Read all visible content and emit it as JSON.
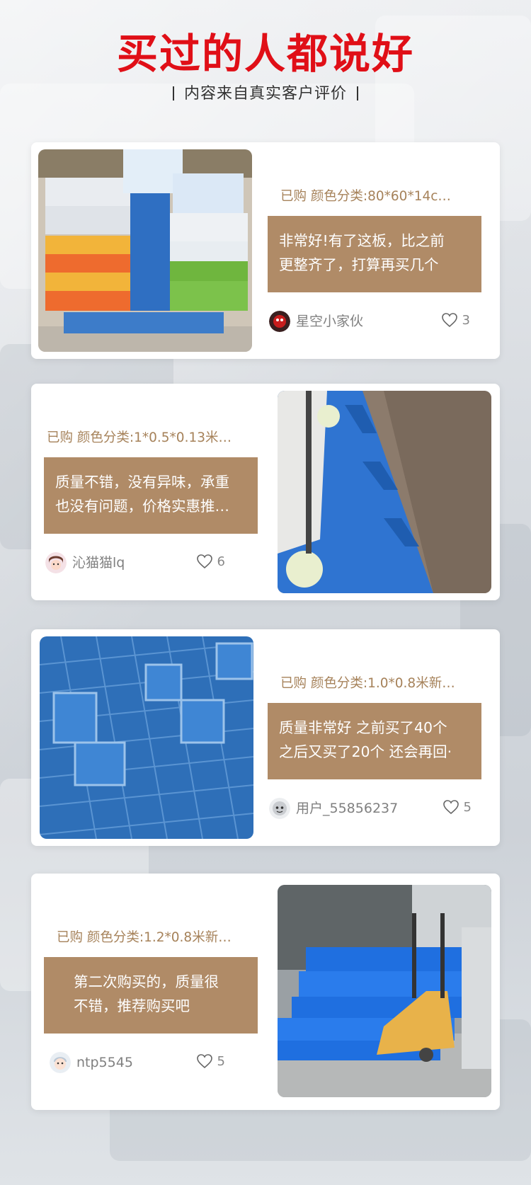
{
  "header": {
    "title": "买过的人都说好",
    "subtitle": "内容来自真实客户评价"
  },
  "colors": {
    "title_red": "#e00f17",
    "review_bg": "#b08b67",
    "purchase_text": "#a6825a",
    "card_bg": "#ffffff"
  },
  "reviews": [
    {
      "purchase": "已购 颜色分类:80*60*14c…",
      "text_lines": [
        "非常好!有了这板，比之前",
        "更整齐了，打算再买几个"
      ],
      "user": "星空小家伙",
      "likes": "3",
      "photo": "pallet-stacked-with-milk-boxes",
      "avatar_icon": "red-character-avatar-icon"
    },
    {
      "purchase": "已购 颜色分类:1*0.5*0.13米…",
      "text_lines": [
        "质量不错，没有异味，承重",
        "也没有问题，价格实惠推…"
      ],
      "user": "沁猫猫lq",
      "likes": "6",
      "photo": "blue-pallet-with-shelf-on-tiles",
      "avatar_icon": "cartoon-girl-avatar-icon"
    },
    {
      "purchase": "已购 颜色分类:1.0*0.8米新…",
      "text_lines": [
        "质量非常好 之前买了40个",
        "之后又买了20个 还会再回·"
      ],
      "user": "用户_55856237",
      "likes": "5",
      "photo": "blue-pallet-grid-underside",
      "avatar_icon": "gray-cartoon-avatar-icon"
    },
    {
      "purchase": "已购 颜色分类:1.2*0.8米新…",
      "text_lines": [
        "第二次购买的，质量很",
        "不错，推荐购买吧"
      ],
      "user": "ntp5545",
      "likes": "5",
      "photo": "blue-pallets-with-hand-truck",
      "avatar_icon": "cartoon-kid-avatar-icon"
    }
  ]
}
